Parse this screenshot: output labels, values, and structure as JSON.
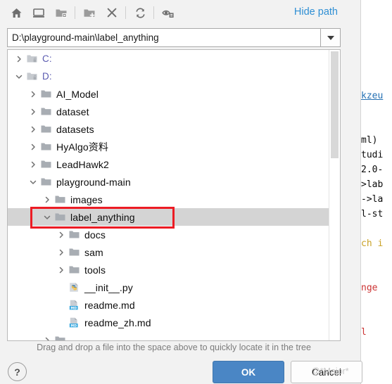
{
  "background_editor": {
    "code_lines": [
      {
        "text": "",
        "cls": "c-plain"
      },
      {
        "text": "",
        "cls": "c-plain"
      },
      {
        "text": "",
        "cls": "c-plain"
      },
      {
        "text": "",
        "cls": "c-plain"
      },
      {
        "text": "",
        "cls": "c-plain"
      },
      {
        "text": "",
        "cls": "c-plain"
      },
      {
        "text": "kzeu",
        "cls": "c-link"
      },
      {
        "text": "",
        "cls": "c-plain"
      },
      {
        "text": "",
        "cls": "c-plain"
      },
      {
        "text": "ml)",
        "cls": "c-plain"
      },
      {
        "text": "tudi",
        "cls": "c-plain"
      },
      {
        "text": "2.0-",
        "cls": "c-plain"
      },
      {
        "text": ">lab",
        "cls": "c-plain"
      },
      {
        "text": "->la",
        "cls": "c-plain"
      },
      {
        "text": "l-st",
        "cls": "c-plain"
      },
      {
        "text": "",
        "cls": "c-plain"
      },
      {
        "text": "ch i",
        "cls": "c-kw"
      },
      {
        "text": "",
        "cls": "c-plain"
      },
      {
        "text": "",
        "cls": "c-plain"
      },
      {
        "text": "nge",
        "cls": "c-red"
      },
      {
        "text": "",
        "cls": "c-plain"
      },
      {
        "text": "",
        "cls": "c-plain"
      },
      {
        "text": "l",
        "cls": "c-red"
      },
      {
        "text": "",
        "cls": "c-plain"
      },
      {
        "text": "",
        "cls": "c-plain"
      },
      {
        "text": "",
        "cls": "c-plain"
      }
    ],
    "watermark": "@*Major*"
  },
  "toolbar": {
    "buttons": [
      {
        "name": "home-icon",
        "tooltip": "Home"
      },
      {
        "name": "desktop-icon",
        "tooltip": "Desktop"
      },
      {
        "name": "project-folder-icon",
        "tooltip": "Project"
      },
      {
        "name": "new-folder-icon",
        "tooltip": "New Folder"
      },
      {
        "name": "delete-icon",
        "tooltip": "Delete"
      },
      {
        "name": "refresh-icon",
        "tooltip": "Refresh"
      },
      {
        "name": "show-hidden-icon",
        "tooltip": "Show Hidden Files"
      }
    ],
    "hide_path_label": "Hide path"
  },
  "path_field": {
    "value": "D:\\playground-main\\label_anything",
    "placeholder": "",
    "dropdown_icon": "chevron-down-icon"
  },
  "tree": {
    "rows": [
      {
        "indent": 0,
        "twisty": "collapsed",
        "icon": "drive-folder-icon",
        "label": "C:",
        "drive": true,
        "selected": false
      },
      {
        "indent": 0,
        "twisty": "expanded",
        "icon": "drive-folder-icon",
        "label": "D:",
        "drive": true,
        "selected": false
      },
      {
        "indent": 1,
        "twisty": "collapsed",
        "icon": "folder-icon",
        "label": "AI_Model",
        "drive": false,
        "selected": false
      },
      {
        "indent": 1,
        "twisty": "collapsed",
        "icon": "folder-icon",
        "label": "dataset",
        "drive": false,
        "selected": false
      },
      {
        "indent": 1,
        "twisty": "collapsed",
        "icon": "folder-icon",
        "label": "datasets",
        "drive": false,
        "selected": false
      },
      {
        "indent": 1,
        "twisty": "collapsed",
        "icon": "folder-icon",
        "label": "HyAlgo资料",
        "drive": false,
        "selected": false
      },
      {
        "indent": 1,
        "twisty": "collapsed",
        "icon": "folder-icon",
        "label": "LeadHawk2",
        "drive": false,
        "selected": false
      },
      {
        "indent": 1,
        "twisty": "expanded",
        "icon": "folder-icon",
        "label": "playground-main",
        "drive": false,
        "selected": false
      },
      {
        "indent": 2,
        "twisty": "collapsed",
        "icon": "folder-icon",
        "label": "images",
        "drive": false,
        "selected": false
      },
      {
        "indent": 2,
        "twisty": "expanded",
        "icon": "folder-icon",
        "label": "label_anything",
        "drive": false,
        "selected": true
      },
      {
        "indent": 3,
        "twisty": "collapsed",
        "icon": "folder-icon",
        "label": "docs",
        "drive": false,
        "selected": false
      },
      {
        "indent": 3,
        "twisty": "collapsed",
        "icon": "folder-icon",
        "label": "sam",
        "drive": false,
        "selected": false
      },
      {
        "indent": 3,
        "twisty": "collapsed",
        "icon": "folder-icon",
        "label": "tools",
        "drive": false,
        "selected": false
      },
      {
        "indent": 3,
        "twisty": "none",
        "icon": "python-file-icon",
        "label": "__init__.py",
        "drive": false,
        "selected": false
      },
      {
        "indent": 3,
        "twisty": "none",
        "icon": "markdown-file-icon",
        "label": "readme.md",
        "drive": false,
        "selected": false
      },
      {
        "indent": 3,
        "twisty": "none",
        "icon": "markdown-file-icon",
        "label": "readme_zh.md",
        "drive": false,
        "selected": false
      },
      {
        "indent": 2,
        "twisty": "collapsed",
        "icon": "folder-icon",
        "label": "",
        "drive": false,
        "selected": false
      }
    ]
  },
  "hint": {
    "text": "Drag and drop a file into the space above to quickly locate it in the tree"
  },
  "footer": {
    "help_label": "?",
    "ok_label": "OK",
    "cancel_label": "Cancel"
  },
  "colors": {
    "accent_blue": "#4a86c5",
    "link_blue": "#2f8fd4",
    "annotation_red": "#ec1c24",
    "selection_grey": "#d4d4d4",
    "drive_label": "#5a5ab0"
  }
}
